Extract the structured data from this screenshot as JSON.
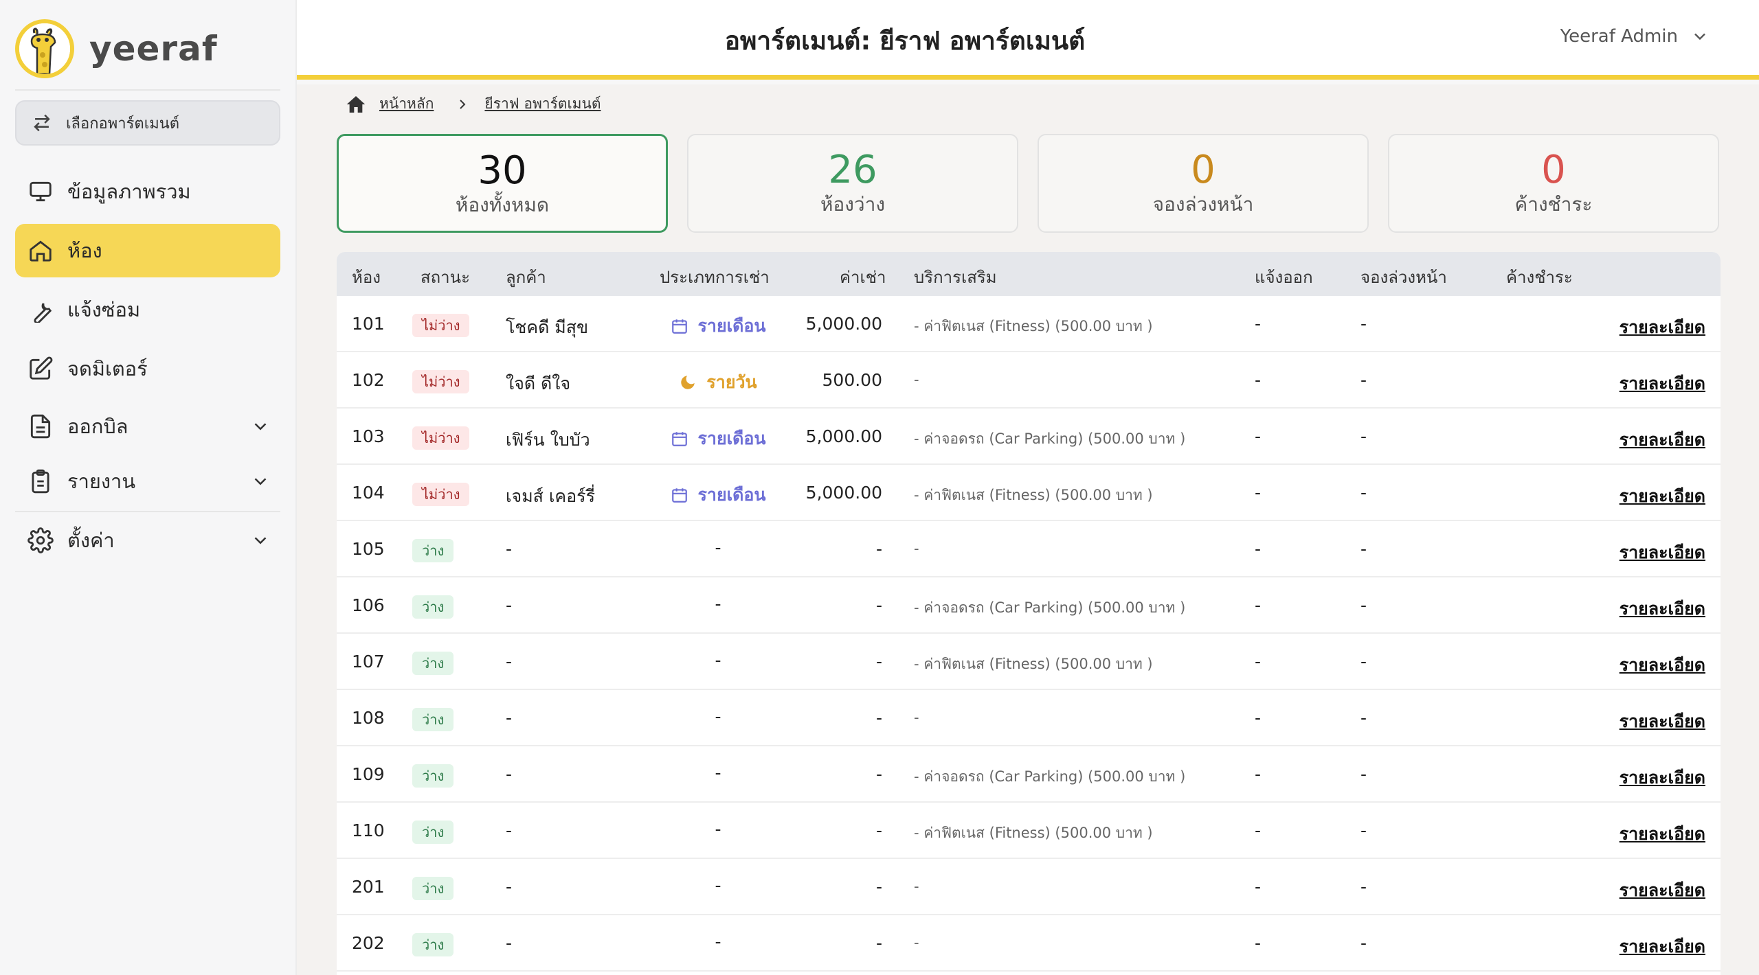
{
  "sidebar": {
    "logo_text": "yeeraf",
    "apartment_select_label": "เลือกอพาร์ตเมนต์",
    "items": [
      {
        "label": "ข้อมูลภาพรวม",
        "icon": "monitor-icon"
      },
      {
        "label": "ห้อง",
        "icon": "home-icon",
        "active": true
      },
      {
        "label": "แจ้งซ่อม",
        "icon": "wrench-icon"
      },
      {
        "label": "จดมิเตอร์",
        "icon": "edit-icon"
      },
      {
        "label": "ออกบิล",
        "icon": "document-icon",
        "expandable": true
      },
      {
        "label": "รายงาน",
        "icon": "clipboard-icon",
        "expandable": true
      },
      {
        "label": "ตั้งค่า",
        "icon": "gear-icon",
        "expandable": true
      }
    ]
  },
  "header": {
    "title": "อพาร์ตเมนต์: ยีราฟ อพาร์ตเมนต์",
    "user": "Yeeraf Admin"
  },
  "breadcrumb": {
    "home": "หน้าหลัก",
    "current": "ยีราฟ อพาร์ตเมนต์"
  },
  "stats": [
    {
      "value": "30",
      "label": "ห้องทั้งหมด",
      "color": "#111111"
    },
    {
      "value": "26",
      "label": "ห้องว่าง",
      "color": "#3e9a60"
    },
    {
      "value": "0",
      "label": "จองล่วงหน้า",
      "color": "#c98a1e"
    },
    {
      "value": "0",
      "label": "ค้างชำระ",
      "color": "#d9534f"
    }
  ],
  "table": {
    "headers": {
      "room": "ห้อง",
      "status": "สถานะ",
      "customer": "ลูกค้า",
      "rent_type": "ประเภทการเช่า",
      "rent": "ค่าเช่า",
      "services": "บริการเสริม",
      "notice": "แจ้งออก",
      "booking": "จองล่วงหน้า",
      "overdue": "ค้างชำระ"
    },
    "detail_label": "รายละเอียด",
    "colors": {
      "monthly": "#6d6fd6",
      "daily": "#e0a12c"
    },
    "rows": [
      {
        "room": "101",
        "status": "ไม่ว่าง",
        "busy": true,
        "customer": "โชคดี มีสุข",
        "rent_type": "รายเดือน",
        "rent_kind": "monthly",
        "rent": "5,000.00",
        "services": "- ค่าฟิตเนส (Fitness) (500.00 บาท )",
        "notice": "-",
        "booking": "-"
      },
      {
        "room": "102",
        "status": "ไม่ว่าง",
        "busy": true,
        "customer": "ใจดี ดีใจ",
        "rent_type": "รายวัน",
        "rent_kind": "daily",
        "rent": "500.00",
        "services": "-",
        "notice": "-",
        "booking": "-"
      },
      {
        "room": "103",
        "status": "ไม่ว่าง",
        "busy": true,
        "customer": "เฟิร์น ใบบัว",
        "rent_type": "รายเดือน",
        "rent_kind": "monthly",
        "rent": "5,000.00",
        "services": "- ค่าจอดรถ (Car Parking) (500.00 บาท )",
        "notice": "-",
        "booking": "-"
      },
      {
        "room": "104",
        "status": "ไม่ว่าง",
        "busy": true,
        "customer": "เจมส์ เคอร์รี่",
        "rent_type": "รายเดือน",
        "rent_kind": "monthly",
        "rent": "5,000.00",
        "services": "- ค่าฟิตเนส (Fitness) (500.00 บาท )",
        "notice": "-",
        "booking": "-"
      },
      {
        "room": "105",
        "status": "ว่าง",
        "busy": false,
        "customer": "-",
        "rent_type": "-",
        "rent_kind": "none",
        "rent": "-",
        "services": "-",
        "notice": "-",
        "booking": "-"
      },
      {
        "room": "106",
        "status": "ว่าง",
        "busy": false,
        "customer": "-",
        "rent_type": "-",
        "rent_kind": "none",
        "rent": "-",
        "services": "- ค่าจอดรถ (Car Parking) (500.00 บาท )",
        "notice": "-",
        "booking": "-"
      },
      {
        "room": "107",
        "status": "ว่าง",
        "busy": false,
        "customer": "-",
        "rent_type": "-",
        "rent_kind": "none",
        "rent": "-",
        "services": "- ค่าฟิตเนส (Fitness) (500.00 บาท )",
        "notice": "-",
        "booking": "-"
      },
      {
        "room": "108",
        "status": "ว่าง",
        "busy": false,
        "customer": "-",
        "rent_type": "-",
        "rent_kind": "none",
        "rent": "-",
        "services": "-",
        "notice": "-",
        "booking": "-"
      },
      {
        "room": "109",
        "status": "ว่าง",
        "busy": false,
        "customer": "-",
        "rent_type": "-",
        "rent_kind": "none",
        "rent": "-",
        "services": "- ค่าจอดรถ (Car Parking) (500.00 บาท )",
        "notice": "-",
        "booking": "-"
      },
      {
        "room": "110",
        "status": "ว่าง",
        "busy": false,
        "customer": "-",
        "rent_type": "-",
        "rent_kind": "none",
        "rent": "-",
        "services": "- ค่าฟิตเนส (Fitness) (500.00 บาท )",
        "notice": "-",
        "booking": "-"
      },
      {
        "room": "201",
        "status": "ว่าง",
        "busy": false,
        "customer": "-",
        "rent_type": "-",
        "rent_kind": "none",
        "rent": "-",
        "services": "-",
        "notice": "-",
        "booking": "-"
      },
      {
        "room": "202",
        "status": "ว่าง",
        "busy": false,
        "customer": "-",
        "rent_type": "-",
        "rent_kind": "none",
        "rent": "-",
        "services": "-",
        "notice": "-",
        "booking": "-"
      }
    ]
  }
}
